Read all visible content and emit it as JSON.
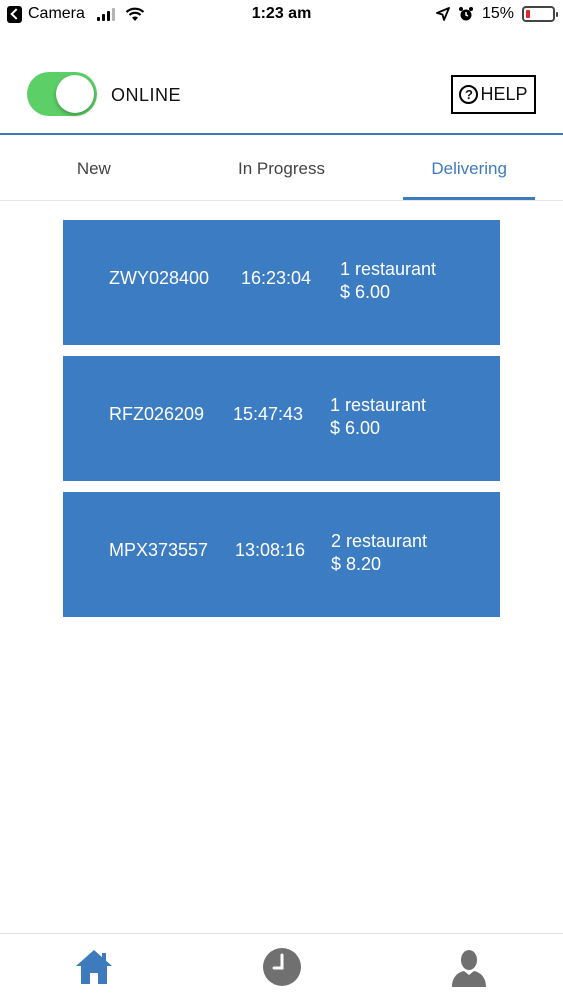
{
  "status_bar": {
    "back_app": "Camera",
    "time": "1:23 am",
    "battery": "15%"
  },
  "header": {
    "toggle_state": "on",
    "status_label": "ONLINE",
    "help_label": "HELP",
    "help_icon": "?"
  },
  "tabs": [
    {
      "label": "New",
      "active": false
    },
    {
      "label": "In Progress",
      "active": false
    },
    {
      "label": "Delivering",
      "active": true
    }
  ],
  "orders": [
    {
      "id": "ZWY028400",
      "time": "16:23:04",
      "restaurants": "1 restaurant",
      "amount": "$ 6.00"
    },
    {
      "id": "RFZ026209",
      "time": "15:47:43",
      "restaurants": "1 restaurant",
      "amount": "$ 6.00"
    },
    {
      "id": "MPX373557",
      "time": "13:08:16",
      "restaurants": "2 restaurant",
      "amount": "$ 8.20"
    }
  ],
  "bottom_nav": {
    "items": [
      {
        "icon": "home-icon",
        "active": true
      },
      {
        "icon": "clock-icon",
        "active": false
      },
      {
        "icon": "profile-icon",
        "active": false
      }
    ]
  },
  "colors": {
    "accent": "#3d7bbd",
    "card": "#3c7cc2",
    "toggle_on": "#5ccf67",
    "nav_inactive": "#707070",
    "battery_low": "#e0262b"
  }
}
